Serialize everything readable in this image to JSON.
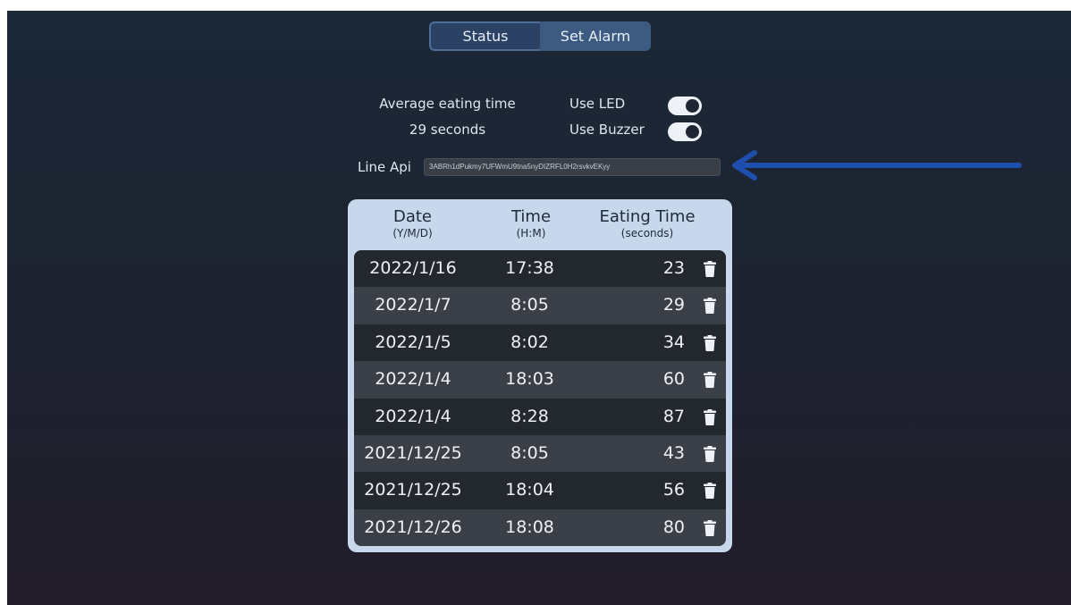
{
  "tabs": [
    {
      "label": "Status",
      "active": true
    },
    {
      "label": "Set Alarm",
      "active": false
    }
  ],
  "stats": {
    "avg_label": "Average eating time",
    "avg_value": "29 seconds"
  },
  "toggles": {
    "led_label": "Use LED",
    "led_on": true,
    "buzzer_label": "Use Buzzer",
    "buzzer_on": true
  },
  "line_api": {
    "label": "Line Api",
    "value": "3ABRh1dPukmy7UFWmU9tna5nyDIZRFL0H2rsvkvEKyy"
  },
  "table": {
    "headers": {
      "date": "Date",
      "date_sub": "(Y/M/D)",
      "time": "Time",
      "time_sub": "(H:M)",
      "eating": "Eating Time",
      "eating_sub": "(seconds)"
    },
    "rows": [
      {
        "date": "2022/1/16",
        "time": "17:38",
        "eating": "23"
      },
      {
        "date": "2022/1/7",
        "time": "8:05",
        "eating": "29"
      },
      {
        "date": "2022/1/5",
        "time": "8:02",
        "eating": "34"
      },
      {
        "date": "2022/1/4",
        "time": "18:03",
        "eating": "60"
      },
      {
        "date": "2022/1/4",
        "time": "8:28",
        "eating": "87"
      },
      {
        "date": "2021/12/25",
        "time": "8:05",
        "eating": "43"
      },
      {
        "date": "2021/12/25",
        "time": "18:04",
        "eating": "56"
      },
      {
        "date": "2021/12/26",
        "time": "18:08",
        "eating": "80"
      }
    ]
  },
  "icons": {
    "delete": "trash-icon",
    "annotation": "arrow-left-icon"
  },
  "colors": {
    "accent": "#3d5a80",
    "table_header": "#c7d7ec",
    "arrow": "#1f4fae"
  }
}
